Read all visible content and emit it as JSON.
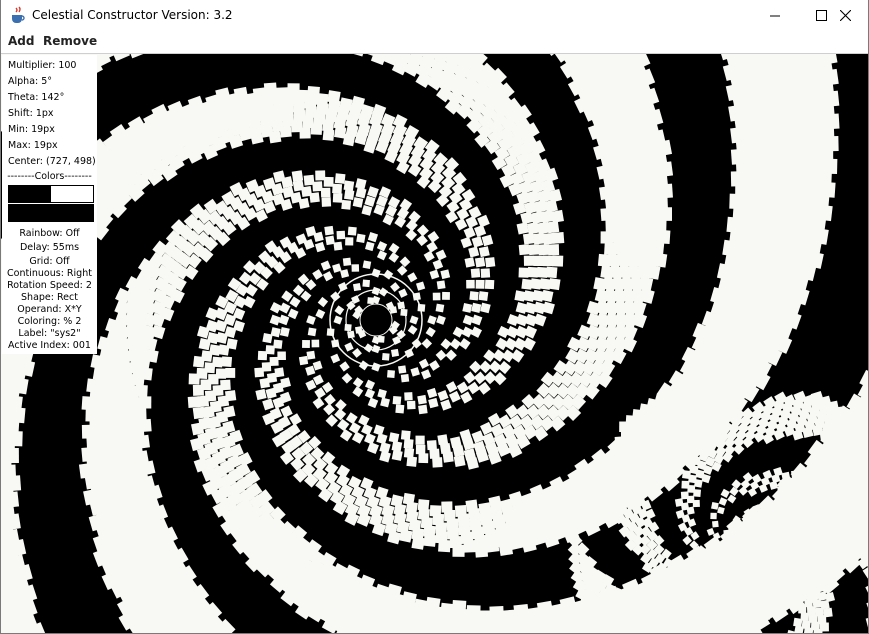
{
  "window": {
    "title": "Celestial Constructor Version: 3.2",
    "app_icon": "java-coffee-cup-icon",
    "controls": [
      "minimize-icon",
      "maximize-icon",
      "close-icon"
    ]
  },
  "menu": {
    "add_label": "Add",
    "remove_label": "Remove"
  },
  "info": {
    "multiplier": "Multiplier: 100",
    "alpha": "Alpha: 5°",
    "theta": "Theta: 142°",
    "shift": "Shift: 1px",
    "min": "Min: 19px",
    "max": "Max: 19px",
    "center": "Center: (727, 498)",
    "colors_header": "--------Colors--------",
    "rainbow": "Rainbow: Off",
    "delay": "Delay: 55ms",
    "grid": "Grid: Off",
    "continuous": "Continuous: Right",
    "rotation_speed": "Rotation Speed: 2",
    "shape": "Shape: Rect",
    "operand": "Operand: X*Y",
    "coloring": "Coloring: % 2",
    "label": "Label: \"sys2\"",
    "active_index": "Active Index: 001"
  },
  "colors": {
    "swatch_1": "#000000",
    "swatch_2": "#ffffff",
    "swatch_3": "#000000",
    "canvas_background": "#000000",
    "pattern_fill": "#f8f8f4"
  }
}
